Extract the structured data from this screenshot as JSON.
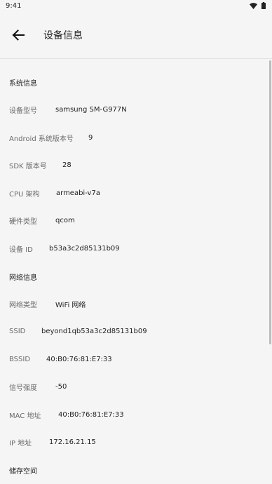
{
  "status_bar": {
    "time": "9:41"
  },
  "app_bar": {
    "title": "设备信息"
  },
  "sections": {
    "system": "系统信息",
    "network": "网络信息",
    "storage": "储存空间"
  },
  "rows": [
    {
      "label": "设备型号",
      "value": "samsung SM-G977N"
    },
    {
      "label": "Android 系统版本号",
      "value": "9"
    },
    {
      "label": "SDK 版本号",
      "value": "28"
    },
    {
      "label": "CPU 架构",
      "value": "armeabi-v7a"
    },
    {
      "label": "硬件类型",
      "value": "qcom"
    },
    {
      "label": "设备 ID",
      "value": "b53a3c2d85131b09"
    },
    {
      "label": "网络类型",
      "value": "WiFi 网络"
    },
    {
      "label": "SSID",
      "value": "beyond1qb53a3c2d85131b09"
    },
    {
      "label": "BSSID",
      "value": "40:B0:76:81:E7:33"
    },
    {
      "label": "信号强度",
      "value": "-50"
    },
    {
      "label": "MAC 地址",
      "value": "40:B0:76:81:E7:33"
    },
    {
      "label": "IP 地址",
      "value": "172.16.21.15"
    }
  ]
}
